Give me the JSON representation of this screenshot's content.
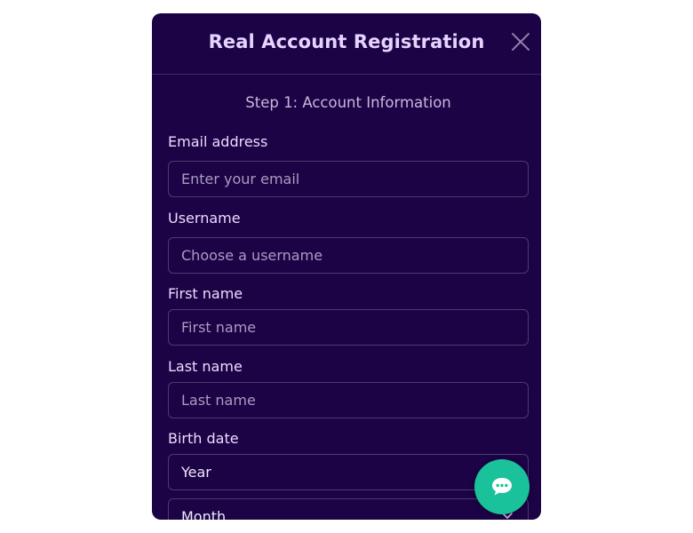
{
  "modal": {
    "title": "Real Account Registration",
    "step_title": "Step 1: Account Information"
  },
  "form": {
    "email": {
      "label": "Email address",
      "placeholder": "Enter your email",
      "value": ""
    },
    "username": {
      "label": "Username",
      "placeholder": "Choose a username",
      "value": ""
    },
    "first_name": {
      "label": "First name",
      "placeholder": "First name",
      "value": ""
    },
    "last_name": {
      "label": "Last name",
      "placeholder": "Last name",
      "value": ""
    },
    "birth_date": {
      "label": "Birth date",
      "year_selected": "Year",
      "month_selected": "Month"
    }
  },
  "colors": {
    "modal_bg": "#1c0345",
    "title": "#e4d4ff",
    "chat_button": "#19c29a"
  },
  "icons": {
    "close": "close-icon",
    "chevron": "chevron-down-icon",
    "chat": "chat-bubble-icon"
  }
}
